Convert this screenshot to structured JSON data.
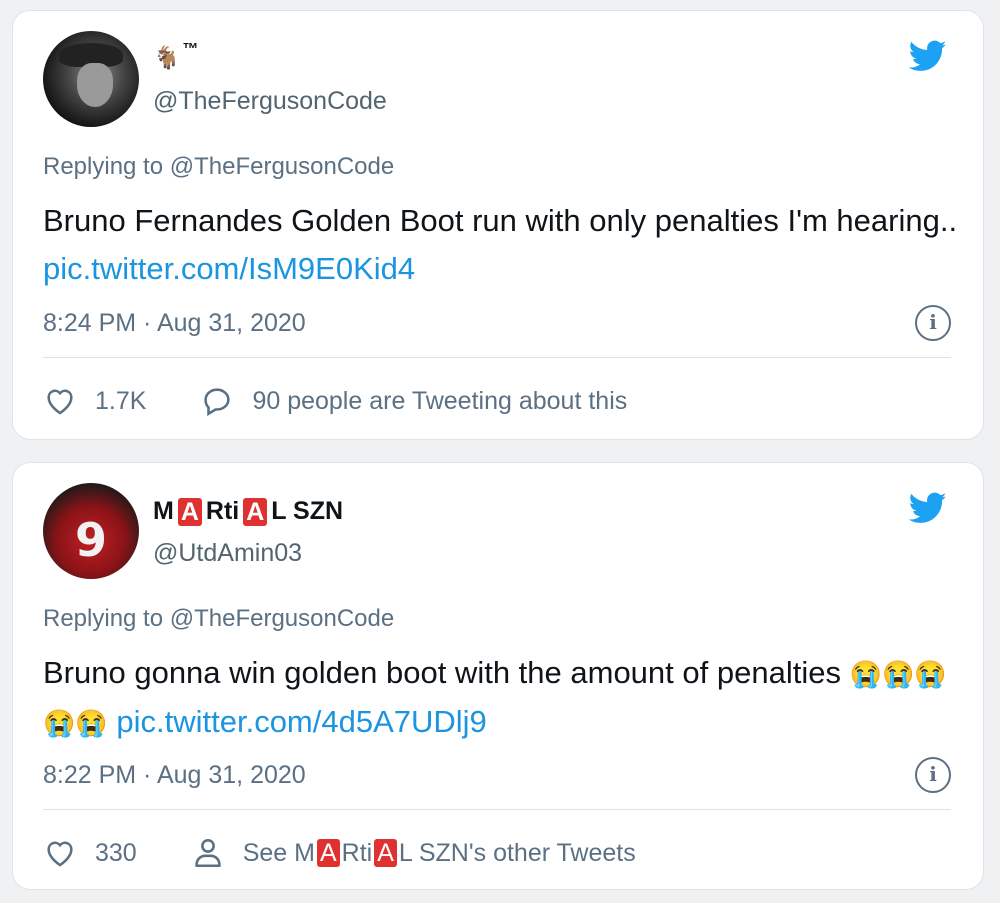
{
  "colors": {
    "link": "#1b95e0",
    "muted": "#5b7083",
    "twitter_blue": "#1da1f2",
    "badge_red": "#e03131"
  },
  "tweets": [
    {
      "display_name": {
        "emoji": "🐐",
        "trademark": "™"
      },
      "handle": "@TheFergusonCode",
      "replying_to": "Replying to @TheFergusonCode",
      "text": "Bruno Fernandes Golden Boot run with only penalties I'm hearing.. ",
      "link": "pic.twitter.com/IsM9E0Kid4",
      "timestamp": "8:24 PM · Aug 31, 2020",
      "likes": "1.7K",
      "secondary_action": "90 people are Tweeting about this",
      "icons": [
        "heart-icon",
        "comment-icon",
        "twitter-bird-icon",
        "info-icon"
      ]
    },
    {
      "display_name": {
        "parts": [
          "M",
          "A",
          "Rti",
          "A",
          "L SZN"
        ]
      },
      "avatar_number": "9",
      "handle": "@UtdAmin03",
      "replying_to": "Replying to @TheFergusonCode",
      "text": "Bruno gonna win golden boot with the amount of penalties ",
      "emojis": [
        "😭",
        "😭",
        "😭",
        "😭",
        "😭"
      ],
      "link": "pic.twitter.com/4d5A7UDlj9",
      "timestamp": "8:22 PM · Aug 31, 2020",
      "likes": "330",
      "secondary_action": {
        "prefix": "See M",
        "a1": "A",
        "mid": "Rti",
        "a2": "A",
        "suffix": "L SZN's other Tweets"
      },
      "icons": [
        "heart-icon",
        "person-icon",
        "twitter-bird-icon",
        "info-icon"
      ]
    }
  ]
}
